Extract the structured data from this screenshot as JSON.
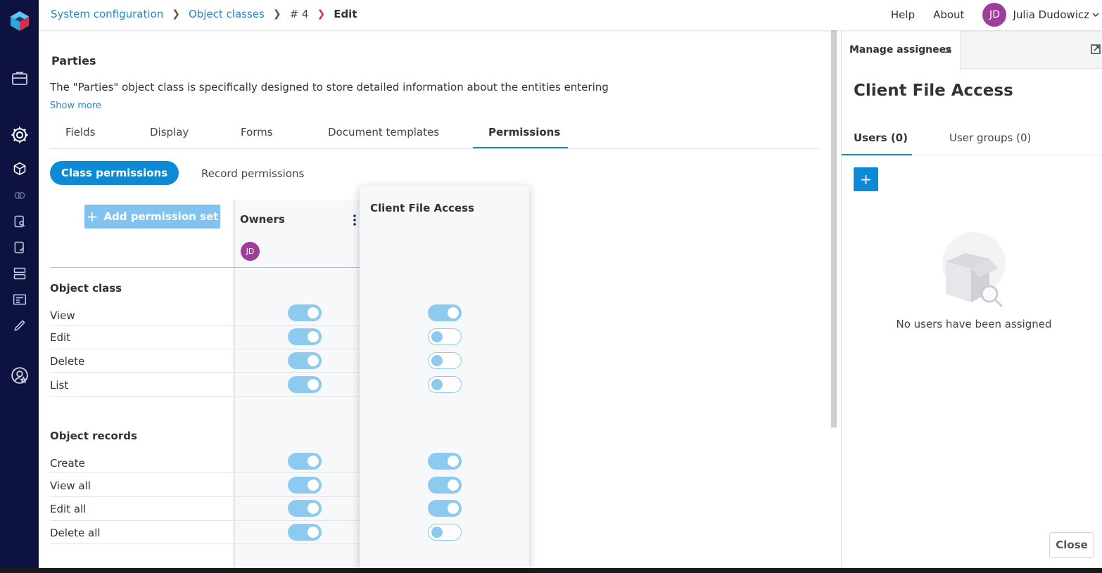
{
  "breadcrumb": {
    "items": [
      "System configuration",
      "Object classes",
      "# 4",
      "Edit"
    ]
  },
  "header": {
    "help": "Help",
    "about": "About",
    "user_initials": "JD",
    "user_name": "Julia Dudowicz"
  },
  "page": {
    "title": "Parties",
    "description": "The \"Parties\" object class is specifically designed to store detailed information about the entities entering",
    "show_more": "Show more"
  },
  "tabs": [
    "Fields",
    "Display",
    "Forms",
    "Document templates",
    "Permissions"
  ],
  "active_tab": "Permissions",
  "perm_modes": {
    "class": "Class permissions",
    "record": "Record permissions"
  },
  "add_permission_set": "Add permission set",
  "owners": {
    "title": "Owners",
    "avatar_initials": "JD"
  },
  "drag_card": {
    "title": "Client File Access"
  },
  "sections": {
    "object_class": {
      "title": "Object class",
      "rows": [
        {
          "label": "View",
          "owners": true,
          "client": true
        },
        {
          "label": "Edit",
          "owners": true,
          "client": false
        },
        {
          "label": "Delete",
          "owners": true,
          "client": false
        },
        {
          "label": "List",
          "owners": true,
          "client": false
        }
      ]
    },
    "object_records": {
      "title": "Object records",
      "rows": [
        {
          "label": "Create",
          "owners": true,
          "client": true
        },
        {
          "label": "View all",
          "owners": true,
          "client": true
        },
        {
          "label": "Edit all",
          "owners": true,
          "client": true
        },
        {
          "label": "Delete all",
          "owners": true,
          "client": false
        }
      ]
    }
  },
  "assignees_panel": {
    "tab_label": "Manage assignees",
    "title": "Client File Access",
    "users_tab": "Users (0)",
    "groups_tab": "User groups (0)",
    "add_label": "+",
    "empty_text": "No users have been assigned",
    "close": "Close"
  },
  "colors": {
    "nav_bg": "#0d1240",
    "accent": "#0c8ad6",
    "link": "#1e88c9",
    "toggle": "#8ccaf0",
    "avatar": "#9c3e9a"
  }
}
